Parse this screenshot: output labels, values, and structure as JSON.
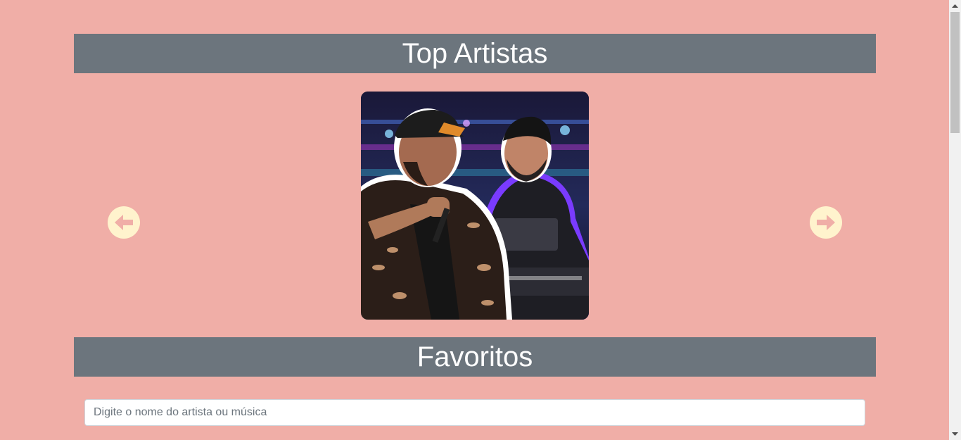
{
  "top_artists": {
    "title": "Top Artistas",
    "image_alt": "Dupla sertaneja no palco"
  },
  "favorites": {
    "title": "Favoritos",
    "search_placeholder": "Digite o nome do artista ou música"
  },
  "icons": {
    "prev": "arrow-left-circle-icon",
    "next": "arrow-right-circle-icon"
  },
  "colors": {
    "background": "#f0aea7",
    "header": "#6c757d",
    "arrow": "#fff3cd"
  }
}
